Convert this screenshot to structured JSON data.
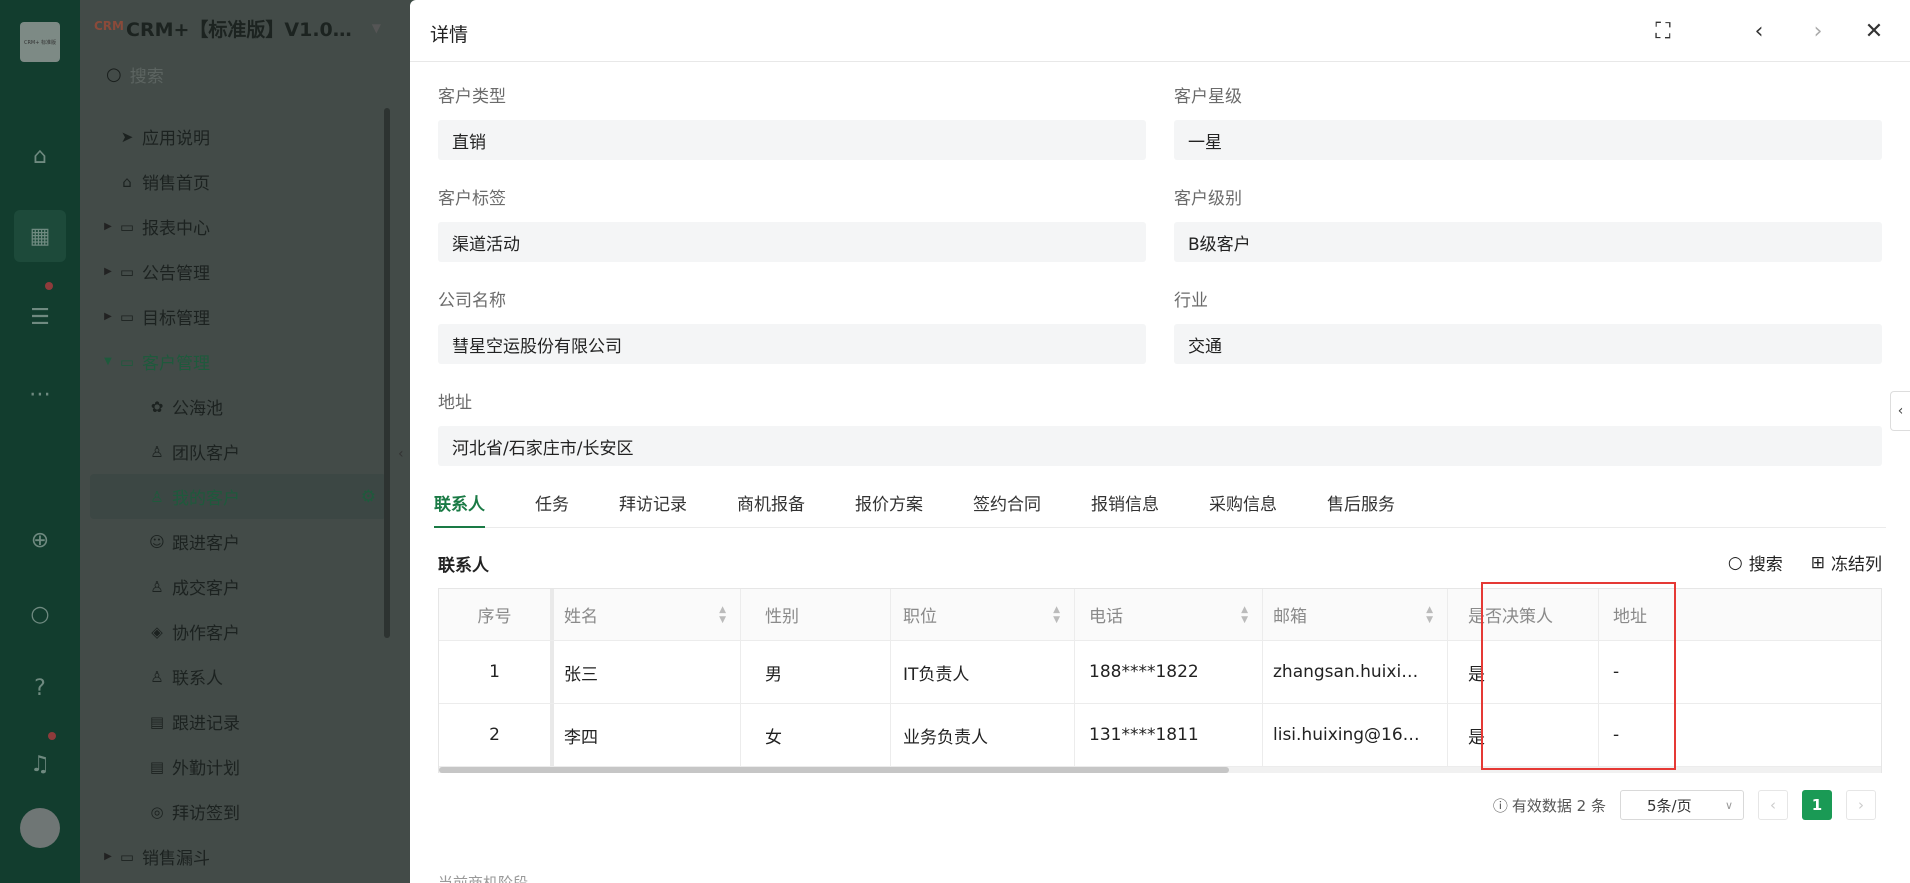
{
  "app": {
    "title": "CRM+【标准版】V1.0…",
    "logo_text": "CRM",
    "search_placeholder": "搜索"
  },
  "rail": {
    "logo_text": "CRM+ 标准版",
    "icons": [
      "home-icon",
      "grid-icon",
      "doc-icon",
      "more-icon",
      "add-icon",
      "search-icon",
      "help-icon",
      "bell-icon"
    ]
  },
  "sidebar": {
    "items": [
      {
        "label": "应用说明",
        "icon": "send-icon",
        "level": 1
      },
      {
        "label": "销售首页",
        "icon": "home-icon",
        "level": 1
      },
      {
        "label": "报表中心",
        "icon": "folder-icon",
        "level": 1,
        "expandable": true
      },
      {
        "label": "公告管理",
        "icon": "folder-icon",
        "level": 1,
        "expandable": true
      },
      {
        "label": "目标管理",
        "icon": "folder-icon",
        "level": 1,
        "expandable": true
      },
      {
        "label": "客户管理",
        "icon": "folder-icon",
        "level": 1,
        "expandable": true,
        "open": true
      },
      {
        "label": "公海池",
        "icon": "handshake-icon",
        "level": 2
      },
      {
        "label": "团队客户",
        "icon": "team-icon",
        "level": 2
      },
      {
        "label": "我的客户",
        "icon": "user-icon",
        "level": 2,
        "selected": true
      },
      {
        "label": "跟进客户",
        "icon": "follow-icon",
        "level": 2
      },
      {
        "label": "成交客户",
        "icon": "deal-icon",
        "level": 2
      },
      {
        "label": "协作客户",
        "icon": "collab-icon",
        "level": 2
      },
      {
        "label": "联系人",
        "icon": "contact-icon",
        "level": 2
      },
      {
        "label": "跟进记录",
        "icon": "record-icon",
        "level": 2
      },
      {
        "label": "外勤计划",
        "icon": "plan-icon",
        "level": 2
      },
      {
        "label": "拜访签到",
        "icon": "location-icon",
        "level": 2
      },
      {
        "label": "销售漏斗",
        "icon": "folder-icon",
        "level": 1,
        "expandable": true
      }
    ]
  },
  "drawer": {
    "title": "详情",
    "fields": {
      "customer_type": {
        "label": "客户类型",
        "value": "直销"
      },
      "customer_star": {
        "label": "客户星级",
        "value": "一星"
      },
      "customer_tag": {
        "label": "客户标签",
        "value": "渠道活动"
      },
      "customer_level": {
        "label": "客户级别",
        "value": "B级客户"
      },
      "company": {
        "label": "公司名称",
        "value": "彗星空运股份有限公司"
      },
      "industry": {
        "label": "行业",
        "value": "交通"
      },
      "address": {
        "label": "地址",
        "value": "河北省/石家庄市/长安区"
      }
    },
    "tabs": [
      "联系人",
      "任务",
      "拜访记录",
      "商机报备",
      "报价方案",
      "签约合同",
      "报销信息",
      "采购信息",
      "售后服务"
    ],
    "section_title": "联系人",
    "tools": {
      "search": "搜索",
      "freeze": "冻结列"
    },
    "table": {
      "headers": [
        "序号",
        "姓名",
        "性别",
        "职位",
        "电话",
        "邮箱",
        "是否决策人",
        "地址"
      ],
      "rows": [
        [
          "1",
          "张三",
          "男",
          "IT负责人",
          "188****1822",
          "zhangsan.huixi…",
          "是",
          "-"
        ],
        [
          "2",
          "李四",
          "女",
          "业务负责人",
          "131****1811",
          "lisi.huixing@16…",
          "是",
          "-"
        ]
      ]
    },
    "pager": {
      "summary": "有效数据 2 条",
      "page_size": "5条/页",
      "current_page": "1"
    },
    "bottom_hint": "当前商机阶段"
  },
  "colors": {
    "accent": "#1a7a45",
    "highlight": "#e53935"
  }
}
